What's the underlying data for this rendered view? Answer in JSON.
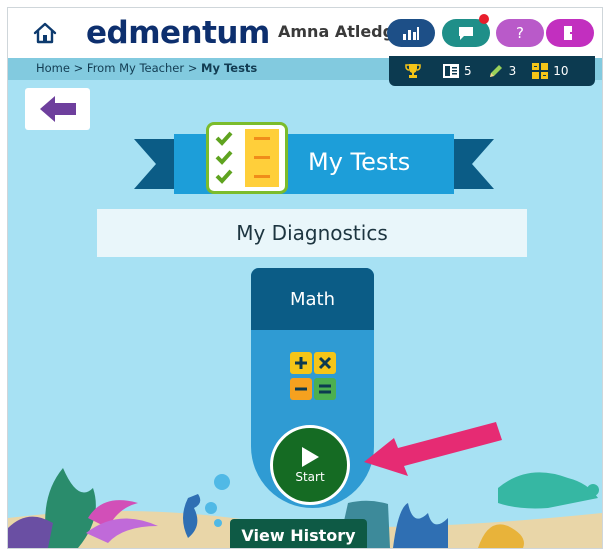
{
  "header": {
    "logo_text": "edmentum",
    "username": "Amna Atledge",
    "buttons": {
      "stats_icon": "bar-chart-icon",
      "chat_icon": "chat-bubble-icon",
      "help_label": "?",
      "logout_icon": "logout-icon"
    }
  },
  "breadcrumb": {
    "home": "Home",
    "sep1": " > ",
    "parent": "From My Teacher",
    "sep2": " > ",
    "current": "My Tests"
  },
  "stats": {
    "trophy": "",
    "assignments_count": "5",
    "pencil_count": "3",
    "grid_count": "10"
  },
  "banner": {
    "title": "My Tests"
  },
  "section": {
    "title": "My Diagnostics"
  },
  "card": {
    "subject": "Math",
    "start_label": "Start"
  },
  "history_button": "View History",
  "colors": {
    "accent": "#0b5c86",
    "start_green": "#156b23",
    "arrow_pink": "#e62b73",
    "sky": "#a7e1f3"
  }
}
